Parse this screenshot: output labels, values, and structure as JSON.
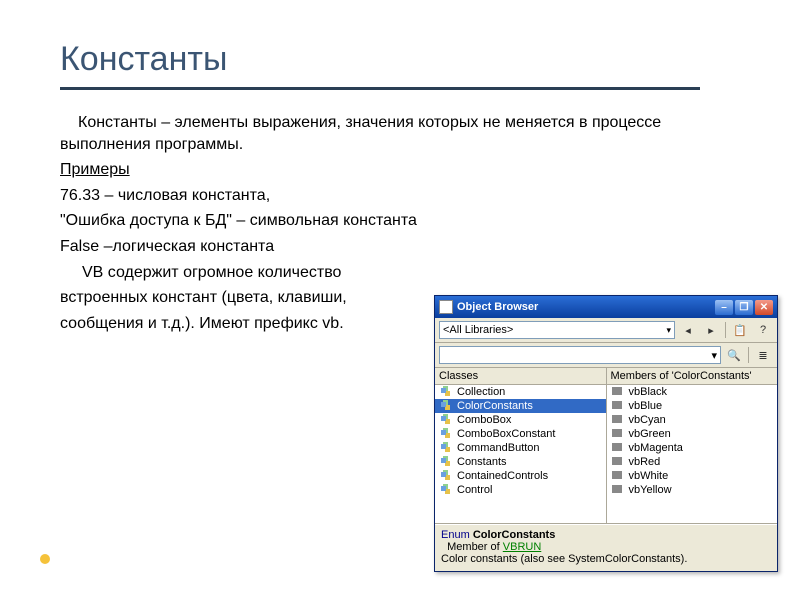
{
  "slide": {
    "title": "Константы",
    "definition": "Константы – элементы выражения, значения которых не меняется в процессе выполнения программы.",
    "examples_label": "Примеры",
    "ex1": "76.33 – числовая константа,",
    "ex2": "\"Ошибка доступа к БД\" – символьная константа",
    "ex3": "False –логическая константа",
    "line4": "VB содержит огромное количество",
    "line5": "встроенных констант (цвета, клавиши,",
    "line6": "сообщения и т.д.). Имеют префикс vb."
  },
  "object_browser": {
    "title": "Object Browser",
    "library_selected": "<All Libraries>",
    "panes": {
      "classes_header": "Classes",
      "members_header": "Members of 'ColorConstants'",
      "classes": [
        "Collection",
        "ColorConstants",
        "ComboBox",
        "ComboBoxConstant",
        "CommandButton",
        "Constants",
        "ContainedControls",
        "Control"
      ],
      "classes_selected_index": 1,
      "members": [
        "vbBlack",
        "vbBlue",
        "vbCyan",
        "vbGreen",
        "vbMagenta",
        "vbRed",
        "vbWhite",
        "vbYellow"
      ]
    },
    "detail": {
      "keyword": "Enum",
      "name": "ColorConstants",
      "member_of_label": "Member of",
      "library": "VBRUN",
      "description": "Color constants (also see SystemColorConstants)."
    }
  }
}
